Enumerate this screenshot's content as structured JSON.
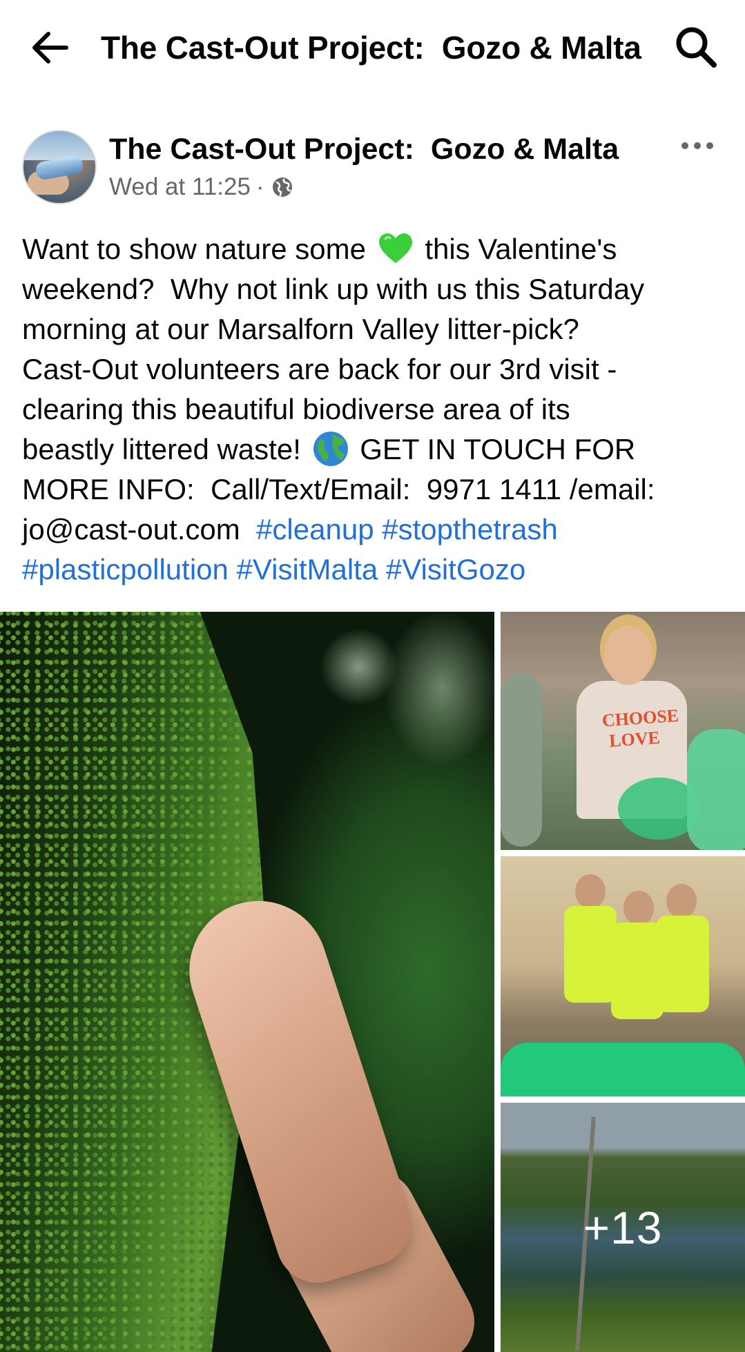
{
  "header": {
    "title": "The Cast-Out Project:  Gozo & Malta",
    "back_icon": "arrow-left-icon",
    "search_icon": "search-icon"
  },
  "post": {
    "author": "The Cast-Out Project:  Gozo & Malta",
    "timestamp": "Wed at 11:25",
    "separator": "·",
    "privacy_icon": "globe-icon",
    "text_lines": [
      {
        "before": "Want to show nature some ",
        "after": " this Valentine's"
      },
      {
        "text": "weekend?  Why not link up with us this Saturday"
      },
      {
        "text": "morning at our Marsalforn Valley litter-pick?"
      },
      {
        "text": "Cast-Out volunteers are back for our 3rd visit -"
      },
      {
        "text": "clearing this beautiful biodiverse area of its"
      },
      {
        "before": "beastly littered waste! ",
        "after": " GET IN TOUCH FOR"
      },
      {
        "text": "MORE INFO:  Call/Text/Email:  9971 1411 /email:"
      },
      {
        "text": "jo@cast-out.com  "
      }
    ],
    "emoji": {
      "heart": "green-heart-emoji",
      "globe": "globe-emoji"
    },
    "hashtags_line1": [
      "#cleanup",
      "#stopthetrash"
    ],
    "hashtags_line2": [
      "#plasticpollution",
      "#VisitMalta",
      "#VisitGozo"
    ],
    "photos": {
      "slogan_on_hoodie": "CHOOSE LOVE",
      "more_count": "+13"
    }
  },
  "colors": {
    "text": "#050505",
    "secondary_text": "#65676b",
    "hashtag": "#216fdb",
    "background": "#ffffff"
  }
}
